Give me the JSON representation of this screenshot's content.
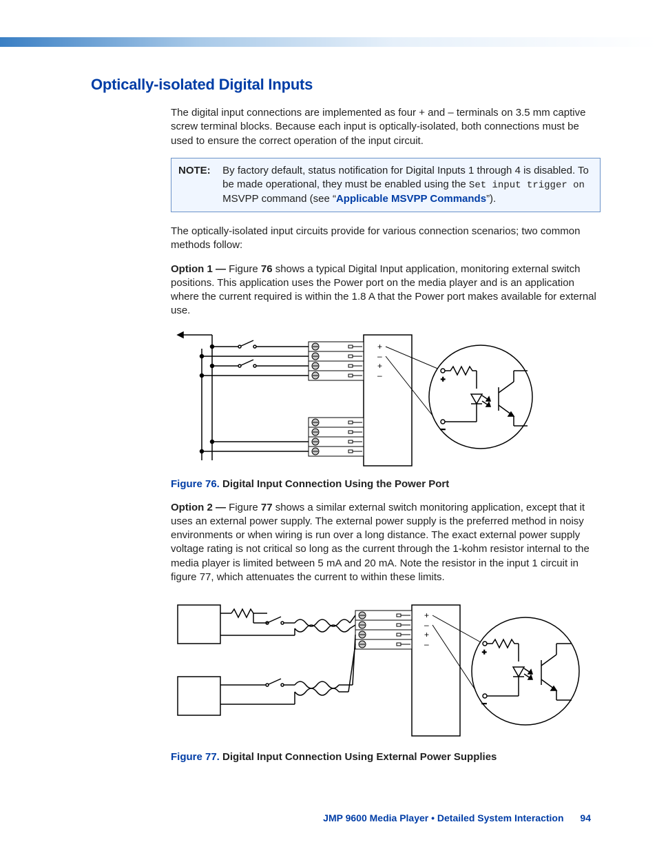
{
  "header": {
    "section_title": "Optically-isolated Digital Inputs"
  },
  "intro_paragraph": "The digital input connections are implemented as four + and – terminals on 3.5 mm captive screw terminal blocks. Because each input is optically-isolated, both connections must be used to ensure the correct operation of the input circuit.",
  "note": {
    "label": "NOTE:",
    "body_prefix": "By factory default, status notification for Digital Inputs 1 through 4 is disabled. To be made operational, they must be enabled using the ",
    "code": "Set input trigger on",
    "body_mid": " MSVPP command (see “",
    "link_text": "Applicable MSVPP Commands",
    "body_suffix": "”)."
  },
  "methods_intro": "The optically-isolated input circuits provide for various connection scenarios; two common methods follow:",
  "option1": {
    "label": "Option 1 — ",
    "fig_ref_prefix": "Figure ",
    "fig_ref_num": "76",
    "text": " shows a typical Digital Input application, monitoring external switch positions. This application uses the Power port on the media player and is an application where the current required is within the 1.8 A that the Power port makes available for external use."
  },
  "figure76": {
    "label": "Figure 76.",
    "title": "Digital Input Connection Using the Power Port",
    "terminal_symbols": [
      "+",
      "–",
      "+",
      "–"
    ],
    "opto_symbols": {
      "plus": "+",
      "minus": "–"
    }
  },
  "option2": {
    "label": "Option 2 — ",
    "fig_ref_prefix": "Figure ",
    "fig_ref_num": "77",
    "text": " shows a similar external switch monitoring application, except that it uses an external power supply. The external power supply is the preferred method in noisy environments or when wiring is run over a long distance. The exact external power supply voltage rating is not critical so long as the current through the 1-kohm resistor internal to the media player is limited between 5 mA and 20 mA. Note the resistor in the input 1 circuit in figure 77, which attenuates the current to within these limits."
  },
  "figure77": {
    "label": "Figure 77.",
    "title": "Digital Input Connection Using External Power Supplies",
    "terminal_symbols": [
      "+",
      "–",
      "+",
      "–"
    ],
    "opto_symbols": {
      "plus": "+",
      "minus": "–"
    }
  },
  "footer": {
    "doc_title": "JMP 9600 Media Player • Detailed System Interaction",
    "page_number": "94"
  }
}
